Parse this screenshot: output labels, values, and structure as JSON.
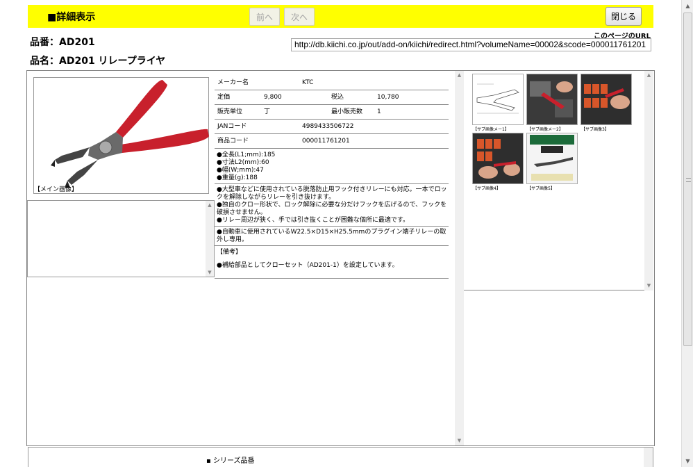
{
  "header": {
    "title": "■詳細表示",
    "prev_label": "前へ",
    "next_label": "次へ",
    "close_label": "閉じる"
  },
  "product": {
    "hinban": "品番：AD201",
    "hinmei": "品名：AD201 リレープライヤ"
  },
  "url": {
    "label": "このページのURL",
    "value": "http://db.kiichi.co.jp/out/add-on/kiichi/redirect.html?volumeName=00002&scode=000011761201"
  },
  "main_image": {
    "caption": "【メイン画像】"
  },
  "info": {
    "maker_label": "メーカー名",
    "maker_value": "KTC",
    "price_label": "定価",
    "price_value": "9,800",
    "tax_label": "税込",
    "tax_value": "10,780",
    "unit_label": "販売単位",
    "unit_value": "丁",
    "minlot_label": "最小販売数",
    "minlot_value": "1",
    "jan_label": "JANコード",
    "jan_value": "4989433506722",
    "code_label": "商品コード",
    "code_value": "000011761201",
    "specs": [
      "●全長(L1;mm):185",
      "●寸法L2(mm):60",
      "●幅(W;mm):47",
      "●重量(g):188"
    ],
    "features": [
      "●大型車などに使用されている脱落防止用フック付きリレーにも対応。一本でロックを解除しながらリレーを引き抜けます。",
      "●独自のクロー形状で、ロック解除に必要な分だけフックを広げるので、フックを破損させません。",
      "●リレー周辺が狭く、手では引き抜くことが困難な個所に最適です。"
    ],
    "usage": "●自動車に使用されているW22.5×D15×H25.5mmのプラグイン端子リレーの取外し専用。",
    "remarks_label": "【備考】",
    "remarks": "●補給部品としてクローセット（AD201-1）を設定しています。"
  },
  "thumbnails": [
    {
      "caption": "【サブ画像メー1】"
    },
    {
      "caption": "【サブ画像メー2】"
    },
    {
      "caption": "【サブ画像3】"
    },
    {
      "caption": "【サブ画像4】"
    },
    {
      "caption": "【サブ画像5】"
    }
  ],
  "bottom": {
    "series_label": "シリーズ品番"
  }
}
